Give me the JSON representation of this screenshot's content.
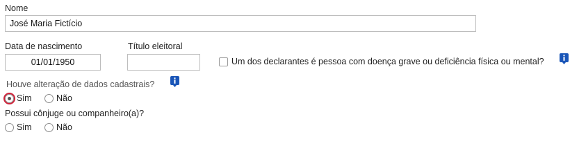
{
  "form": {
    "nome": {
      "label": "Nome",
      "value": "José Maria Fictício"
    },
    "data_nascimento": {
      "label": "Data de nascimento",
      "value": "01/01/1950"
    },
    "titulo_eleitoral": {
      "label": "Título eleitoral",
      "value": ""
    },
    "doenca_grave": {
      "label": "Um dos declarantes é pessoa com doença grave ou deficiência física ou mental?",
      "checked": false
    },
    "alteracao_cadastral": {
      "question": "Houve alteração de dados cadastrais?",
      "options": [
        "Sim",
        "Não"
      ],
      "selected": "Sim"
    },
    "conjuge": {
      "question": "Possui cônjuge ou companheiro(a)?",
      "options": [
        "Sim",
        "Não"
      ],
      "selected": null
    }
  },
  "colors": {
    "info_icon": "#1a56b8",
    "focus_ring": "#d0223a",
    "field_border": "#bdbdbd"
  },
  "icons": {
    "info": "info-icon"
  }
}
